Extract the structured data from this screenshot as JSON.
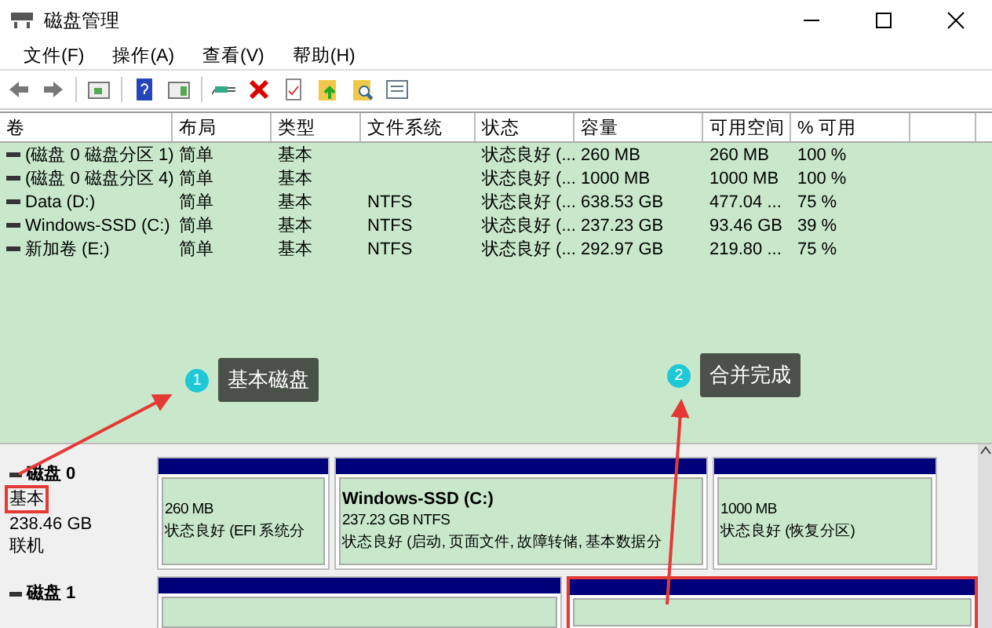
{
  "window": {
    "title": "磁盘管理"
  },
  "menu": [
    "文件(F)",
    "操作(A)",
    "查看(V)",
    "帮助(H)"
  ],
  "table": {
    "columns": [
      "卷",
      "布局",
      "类型",
      "文件系统",
      "状态",
      "容量",
      "可用空间",
      "% 可用"
    ],
    "rows": [
      {
        "cells": [
          "(磁盘 0 磁盘分区 1)",
          "简单",
          "基本",
          "",
          "状态良好 (...",
          "260 MB",
          "260 MB",
          "100 %"
        ]
      },
      {
        "cells": [
          "(磁盘 0 磁盘分区 4)",
          "简单",
          "基本",
          "",
          "状态良好 (...",
          "1000 MB",
          "1000 MB",
          "100 %"
        ]
      },
      {
        "cells": [
          "Data (D:)",
          "简单",
          "基本",
          "NTFS",
          "状态良好 (...",
          "638.53 GB",
          "477.04 ...",
          "75 %"
        ]
      },
      {
        "cells": [
          "Windows-SSD (C:)",
          "简单",
          "基本",
          "NTFS",
          "状态良好 (...",
          "237.23 GB",
          "93.46 GB",
          "39 %"
        ]
      },
      {
        "cells": [
          "新加卷 (E:)",
          "简单",
          "基本",
          "NTFS",
          "状态良好 (...",
          "292.97 GB",
          "219.80 ...",
          "75 %"
        ]
      }
    ]
  },
  "disks": [
    {
      "name": "磁盘 0",
      "type": "基本",
      "type_highlighted": true,
      "size": "238.46 GB",
      "status": "联机",
      "partitions": [
        {
          "kind": "primary",
          "highlighted": false,
          "size": "260 MB",
          "status": "状态良好 (EFI 系统分"
        },
        {
          "kind": "primary",
          "highlighted": false,
          "title": "Windows-SSD  (C:)",
          "size": "237.23 GB NTFS",
          "status": "状态良好 (启动, 页面文件, 故障转储, 基本数据分"
        },
        {
          "kind": "primary",
          "highlighted": false,
          "size": "1000 MB",
          "status": "状态良好 (恢复分区)"
        }
      ]
    },
    {
      "name": "磁盘 1",
      "partitions": [
        {
          "kind": "primary",
          "highlighted": false
        },
        {
          "kind": "primary",
          "highlighted": true
        }
      ]
    }
  ],
  "annotations": [
    {
      "number": "1",
      "text": "基本磁盘"
    },
    {
      "number": "2",
      "text": "合并完成"
    }
  ]
}
